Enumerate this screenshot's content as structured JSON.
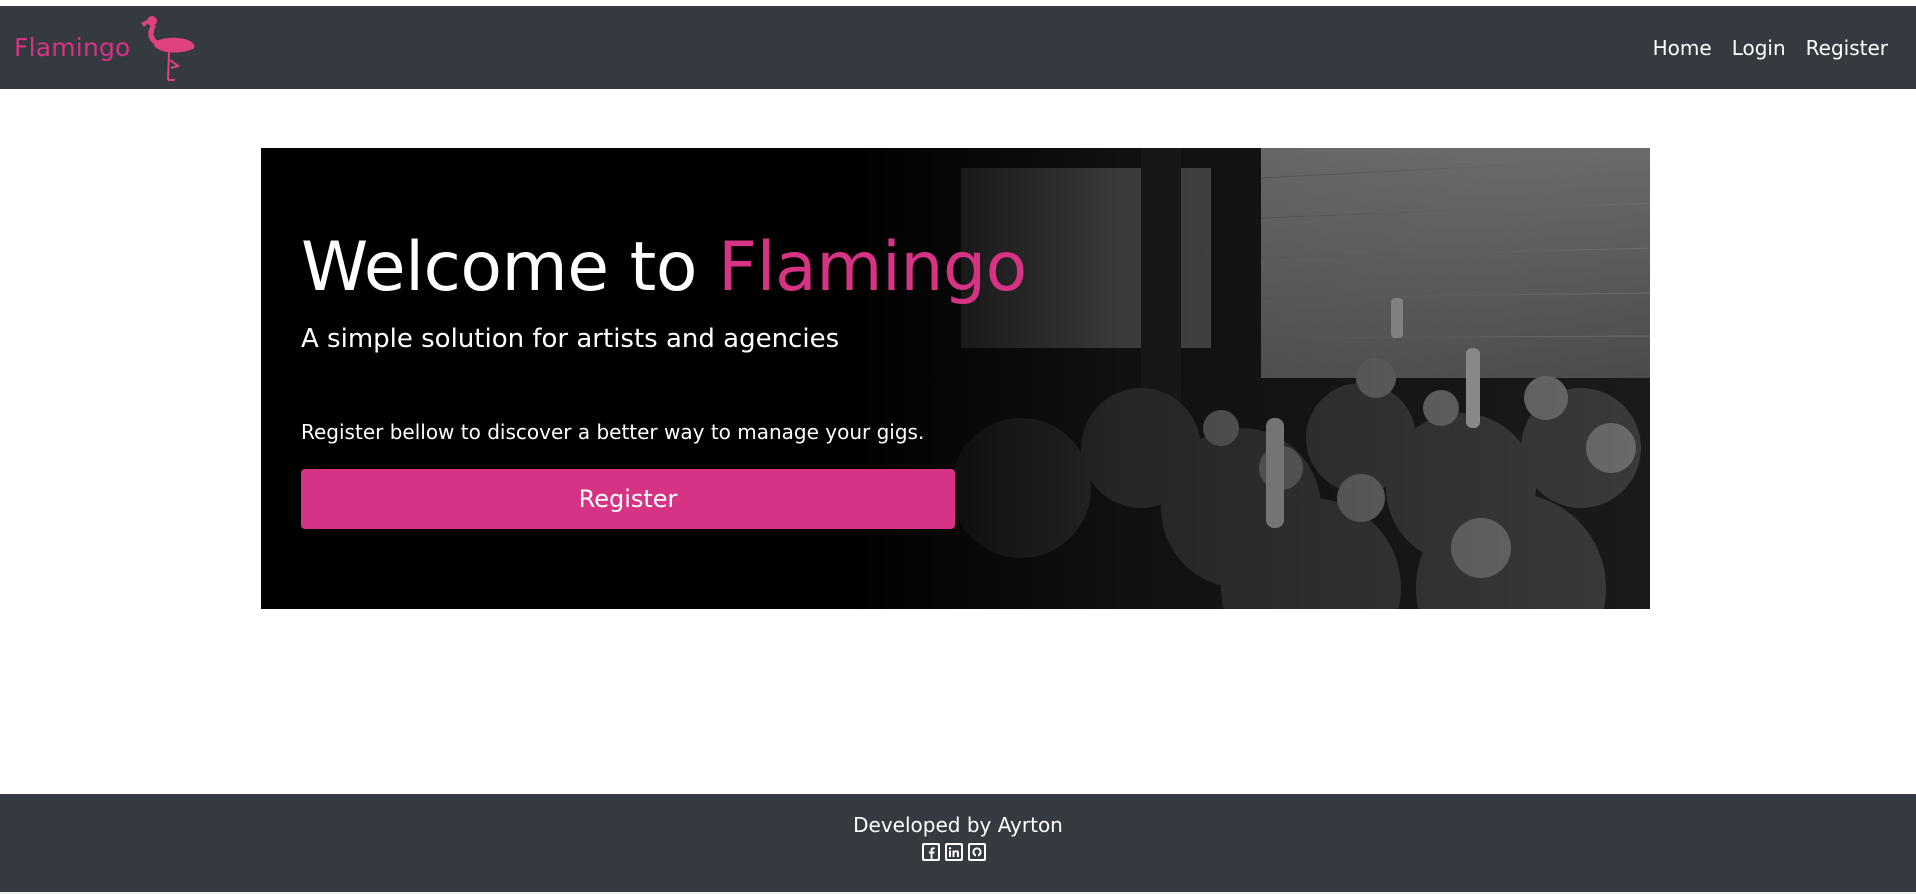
{
  "app": {
    "brand_name": "Flamingo",
    "logo_icon": "flamingo-icon",
    "accent_color": "#d63384",
    "nav_color": "#343a40"
  },
  "nav": {
    "items": [
      {
        "label": "Home"
      },
      {
        "label": "Login"
      },
      {
        "label": "Register"
      }
    ]
  },
  "hero": {
    "title_prefix": "Welcome to ",
    "title_accent": "Flamingo",
    "subtitle": "A simple solution for artists and agencies",
    "text": "Register bellow to discover a better way to manage your gigs.",
    "button_label": "Register",
    "background_icon": "concert-crowd-photo"
  },
  "footer": {
    "text": "Developed by Ayrton",
    "social": [
      {
        "icon": "facebook-icon"
      },
      {
        "icon": "linkedin-icon"
      },
      {
        "icon": "github-icon"
      }
    ]
  }
}
